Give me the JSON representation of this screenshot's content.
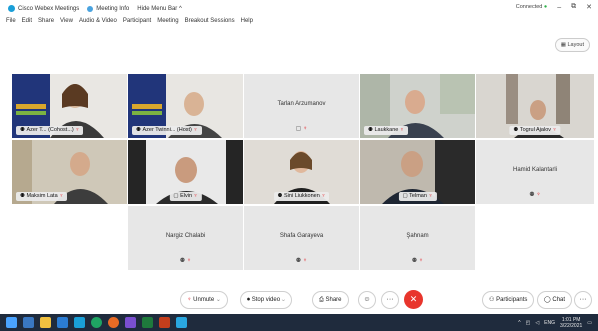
{
  "window": {
    "app_title": "Cisco Webex Meetings",
    "meeting_info": "Meeting Info",
    "hide_menu": "Hide Menu Bar ^",
    "connection": "Connected",
    "minimize": "–",
    "restore": "⧉",
    "close": "✕"
  },
  "menu": [
    "File",
    "Edit",
    "Share",
    "View",
    "Audio & Video",
    "Participant",
    "Meeting",
    "Breakout Sessions",
    "Help"
  ],
  "layout_label": "Layout",
  "tiles": [
    {
      "name": "Azer T... (Cohost...)",
      "type": "video"
    },
    {
      "name": "Azer Twinni... (Host)",
      "type": "video"
    },
    {
      "name": "Tarlan Arzumanov",
      "type": "name"
    },
    {
      "name": "Laukkane",
      "type": "video"
    },
    {
      "name": "Togrul Ajalov",
      "type": "video"
    },
    {
      "name": "Maksim Lata",
      "type": "video"
    },
    {
      "name": "Elvin",
      "type": "video"
    },
    {
      "name": "Sini Liukkonen",
      "type": "video"
    },
    {
      "name": "Telman",
      "type": "video"
    },
    {
      "name": "Hamid Kalantarli",
      "type": "name"
    },
    {
      "name": "Nargiz Chalabi",
      "type": "name"
    },
    {
      "name": "Shafa Garayeva",
      "type": "name"
    },
    {
      "name": "Şahnam",
      "type": "name"
    }
  ],
  "toolbar": {
    "unmute": "Unmute",
    "stop_video": "Stop video",
    "share": "Share",
    "participants": "Participants",
    "chat": "Chat"
  },
  "tray": {
    "lang": "ENG",
    "time": "1:01 PM",
    "date": "3/22/2021"
  },
  "colors": {
    "leave": "#e8352c",
    "mic_muted": "#e2262d",
    "taskbar": "#1f2b3d",
    "tile_bg": "#e7e7e7"
  }
}
